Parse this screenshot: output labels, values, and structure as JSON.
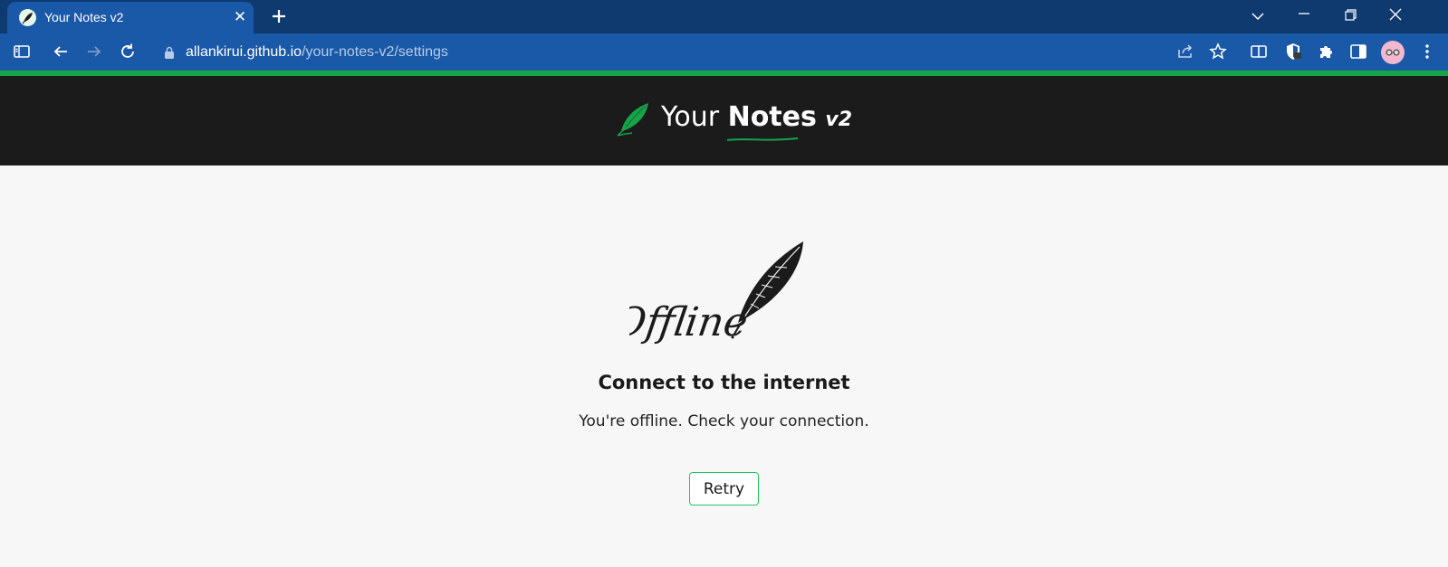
{
  "browser": {
    "tab": {
      "title": "Your Notes v2",
      "close_icon": "close-icon",
      "favicon": "feather-icon"
    },
    "new_tab_icon": "plus-icon",
    "window_controls": [
      "chevron-down-icon",
      "minimize-icon",
      "restore-icon",
      "close-icon"
    ],
    "address": {
      "host": "allankirui.github.io",
      "path": "/your-notes-v2/settings",
      "lock_icon": "lock-icon"
    },
    "toolbar_icons_left": [
      "sidebar-icon",
      "back-arrow-icon",
      "forward-arrow-icon",
      "reload-icon"
    ],
    "toolbar_icons_right": [
      "share-icon",
      "star-icon",
      "split-view-icon",
      "shield-extension-icon",
      "puzzle-extensions-icon",
      "side-panel-icon",
      "profile-avatar",
      "more-vertical-icon"
    ]
  },
  "app": {
    "brand": {
      "prefix": "Your",
      "name": "Notes",
      "version": "v2"
    },
    "offline": {
      "illustration_text": "Offline",
      "heading": "Connect to the internet",
      "message": "You're offline. Check your connection.",
      "retry_label": "Retry"
    }
  },
  "colors": {
    "titlebar": "#0e3a70",
    "toolbar": "#1a58a8",
    "accent_green": "#16a34a",
    "header_bg": "#1b1b1b",
    "page_bg": "#f7f7f7"
  }
}
